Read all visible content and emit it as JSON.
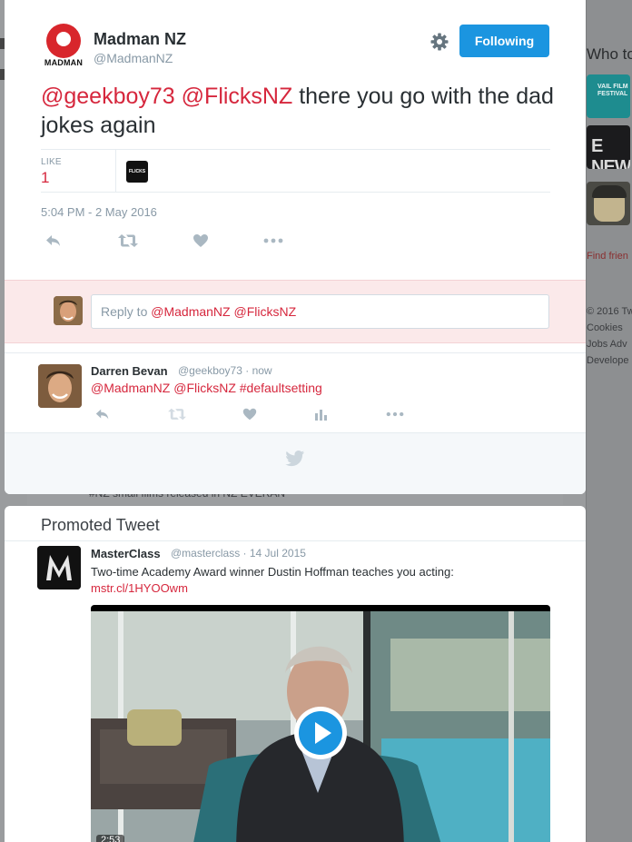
{
  "background": {
    "who_to_follow_heading": "Who to",
    "suggestions": [
      {
        "name": "vail-film-festival",
        "label": "VAIL FILM FESTIVAL"
      },
      {
        "name": "e-news",
        "label": "E NEWS"
      },
      {
        "name": "cartoon-face"
      }
    ],
    "find_friends_link": "Find frien",
    "footer_lines": [
      "© 2016 Tw",
      "Cookies",
      "Jobs  Adv",
      "Develope"
    ],
    "partial_tweet_text": "#NZ small films released in NZ EVERAN"
  },
  "tweet": {
    "author": {
      "name": "Madman NZ",
      "handle": "@MadmanNZ",
      "avatar_text": "MADMAN"
    },
    "follow_button_label": "Following",
    "text_mentions": [
      "@geekboy73",
      "@FlicksNZ"
    ],
    "text_body": " there you go with the dad jokes again",
    "likes_label": "LIKE",
    "likes_count": "1",
    "liker_avatar_text": "FLICKS",
    "timestamp": "5:04 PM - 2 May 2016",
    "actions": [
      "reply-icon",
      "retweet-icon",
      "like-icon",
      "more-icon"
    ]
  },
  "reply_box": {
    "placeholder_prefix": "Reply to ",
    "placeholder_mentions": "@MadmanNZ @FlicksNZ"
  },
  "reply": {
    "author_name": "Darren Bevan",
    "meta": "@geekboy73 · now",
    "text": "@MadmanNZ @FlicksNZ #defaultsetting",
    "actions": [
      "reply-icon",
      "retweet-icon",
      "like-icon",
      "analytics-icon",
      "more-icon"
    ]
  },
  "promoted": {
    "heading": "Promoted Tweet",
    "author_name": "MasterClass",
    "meta": "@masterclass · 14 Jul 2015",
    "text": "Two-time Academy Award winner Dustin Hoffman teaches you acting:",
    "link": "mstr.cl/1HYOOwm",
    "video_duration": "2:53"
  },
  "colors": {
    "accent_red": "#d6273d",
    "follow_blue": "#1b95e0",
    "muted_gray": "#8899a6"
  }
}
